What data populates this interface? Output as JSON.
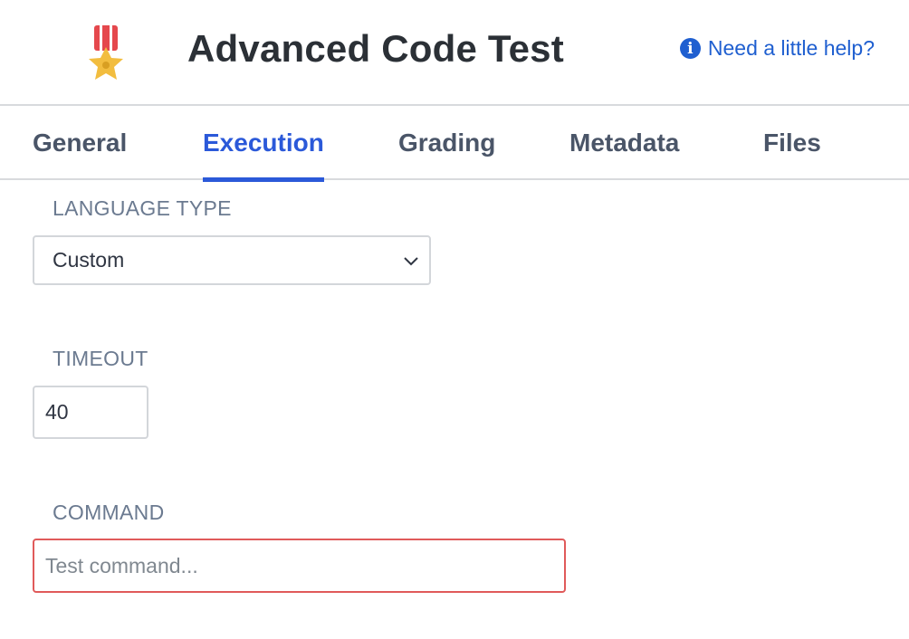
{
  "header": {
    "title": "Advanced Code Test",
    "help_text": "Need a little help?",
    "icons": {
      "medal": "medal-icon",
      "info": "info-icon"
    }
  },
  "tabs": [
    {
      "label": "General",
      "active": false
    },
    {
      "label": "Execution",
      "active": true
    },
    {
      "label": "Grading",
      "active": false
    },
    {
      "label": "Metadata",
      "active": false
    },
    {
      "label": "Files",
      "active": false
    }
  ],
  "form": {
    "language_type": {
      "label": "LANGUAGE TYPE",
      "value": "Custom"
    },
    "timeout": {
      "label": "TIMEOUT",
      "value": "40"
    },
    "command": {
      "label": "COMMAND",
      "value": "",
      "placeholder": "Test command...",
      "state": "error"
    }
  },
  "colors": {
    "accent": "#2b59d9",
    "link": "#1f5fd0",
    "error_border": "#e05a5a",
    "label": "#6b7a90"
  }
}
